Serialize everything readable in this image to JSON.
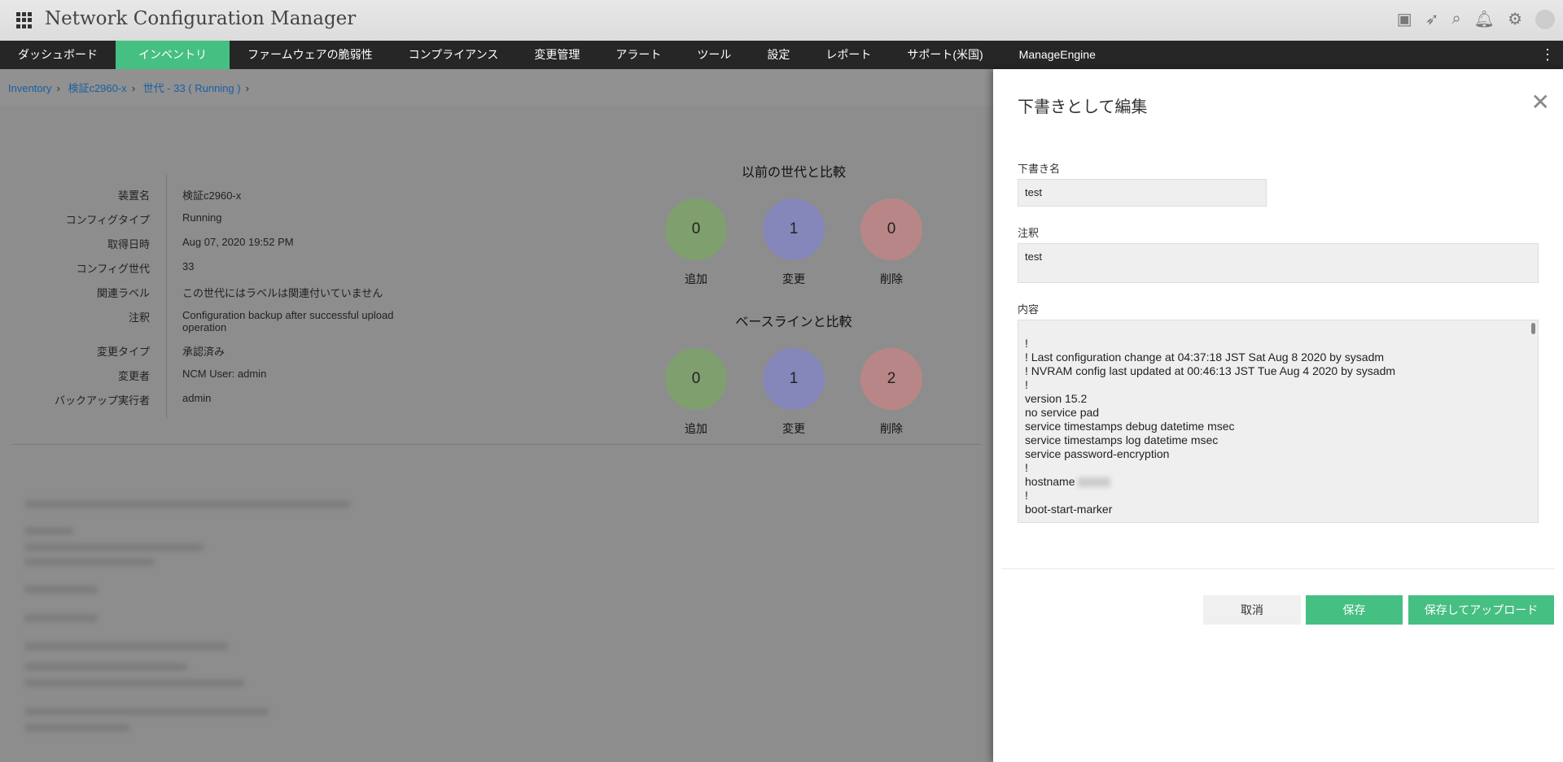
{
  "header": {
    "title": "Network Configuration Manager",
    "icons": [
      "presentation-icon",
      "rocket-icon",
      "search-icon",
      "bell-icon",
      "gear-icon",
      "user-avatar-icon"
    ]
  },
  "nav": [
    "ダッシュボード",
    "インベントリ",
    "ファームウェアの脆弱性",
    "コンプライアンス",
    "変更管理",
    "アラート",
    "ツール",
    "設定",
    "レポート",
    "サポート(米国)",
    "ManageEngine"
  ],
  "breadcrumb": [
    "Inventory",
    "検証c2960-x",
    "世代 - 33 ( Running )"
  ],
  "info": [
    {
      "label": "装置名",
      "value": "検証c2960-x"
    },
    {
      "label": "コンフィグタイプ",
      "value": "Running"
    },
    {
      "label": "取得日時",
      "value": "Aug 07, 2020 19:52 PM"
    },
    {
      "label": "コンフィグ世代",
      "value": "33"
    },
    {
      "label": "関連ラベル",
      "value": "この世代にはラベルは関連付いていません"
    },
    {
      "label": "注釈",
      "value": "Configuration backup after successful upload operation"
    },
    {
      "label": "変更タイプ",
      "value": "承認済み"
    },
    {
      "label": "変更者",
      "value": "NCM User: admin"
    },
    {
      "label": "バックアップ実行者",
      "value": "admin"
    }
  ],
  "compare_prev": {
    "title": "以前の世代と比較",
    "added": "0",
    "changed": "1",
    "deleted": "0"
  },
  "compare_base": {
    "title": "ベースラインと比較",
    "added": "0",
    "changed": "1",
    "deleted": "2"
  },
  "labels": {
    "added": "追加",
    "changed": "変更",
    "deleted": "削除"
  },
  "colors": {
    "green": "#7f9f6e",
    "purple": "#8587bb",
    "red": "#b98687",
    "accent": "#46bf82"
  },
  "panel": {
    "title": "下書きとして編集",
    "draft_name_label": "下書き名",
    "draft_name": "test",
    "note_label": "注釈",
    "note": "test",
    "content_label": "内容",
    "content_lines": [
      "!",
      "! Last configuration change at 04:37:18 JST Sat Aug 8 2020 by sysadm",
      "! NVRAM config last updated at 00:46:13 JST Tue Aug 4 2020 by sysadm",
      "!",
      "version 15.2",
      "no service pad",
      "service timestamps debug datetime msec",
      "service timestamps log datetime msec",
      "service password-encryption",
      "!",
      "hostname",
      "!",
      "boot-start-marker"
    ],
    "cancel": "取消",
    "save": "保存",
    "save_upload": "保存してアップロード"
  }
}
